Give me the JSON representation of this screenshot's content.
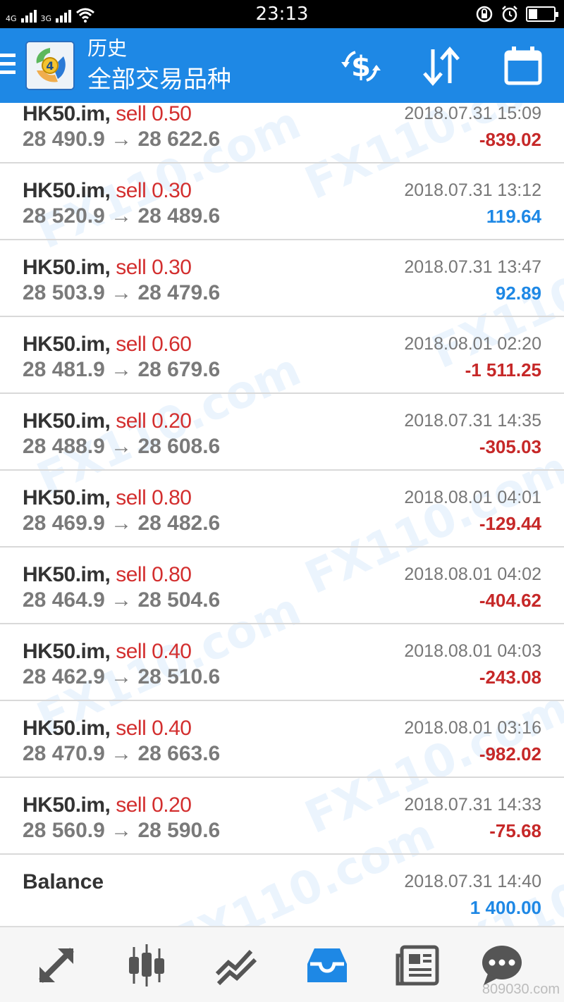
{
  "status_bar": {
    "network_1": "4G",
    "network_2": "3G",
    "time": "23:13"
  },
  "app_bar": {
    "title": "历史",
    "subtitle": "全部交易品种",
    "icons": [
      "menu-icon",
      "metatrader-logo",
      "currency-exchange-icon",
      "sort-icon",
      "calendar-icon"
    ]
  },
  "trades": [
    {
      "symbol": "HK50.im,",
      "side": "sell 0.50",
      "open": "28 490.9",
      "close": "28 622.6",
      "time": "2018.07.31 15:09",
      "profit": "-839.02",
      "sign": "neg"
    },
    {
      "symbol": "HK50.im,",
      "side": "sell 0.30",
      "open": "28 520.9",
      "close": "28 489.6",
      "time": "2018.07.31 13:12",
      "profit": "119.64",
      "sign": "pos"
    },
    {
      "symbol": "HK50.im,",
      "side": "sell 0.30",
      "open": "28 503.9",
      "close": "28 479.6",
      "time": "2018.07.31 13:47",
      "profit": "92.89",
      "sign": "pos"
    },
    {
      "symbol": "HK50.im,",
      "side": "sell 0.60",
      "open": "28 481.9",
      "close": "28 679.6",
      "time": "2018.08.01 02:20",
      "profit": "-1 511.25",
      "sign": "neg"
    },
    {
      "symbol": "HK50.im,",
      "side": "sell 0.20",
      "open": "28 488.9",
      "close": "28 608.6",
      "time": "2018.07.31 14:35",
      "profit": "-305.03",
      "sign": "neg"
    },
    {
      "symbol": "HK50.im,",
      "side": "sell 0.80",
      "open": "28 469.9",
      "close": "28 482.6",
      "time": "2018.08.01 04:01",
      "profit": "-129.44",
      "sign": "neg"
    },
    {
      "symbol": "HK50.im,",
      "side": "sell 0.80",
      "open": "28 464.9",
      "close": "28 504.6",
      "time": "2018.08.01 04:02",
      "profit": "-404.62",
      "sign": "neg"
    },
    {
      "symbol": "HK50.im,",
      "side": "sell 0.40",
      "open": "28 462.9",
      "close": "28 510.6",
      "time": "2018.08.01 04:03",
      "profit": "-243.08",
      "sign": "neg"
    },
    {
      "symbol": "HK50.im,",
      "side": "sell 0.40",
      "open": "28 470.9",
      "close": "28 663.6",
      "time": "2018.08.01 03:16",
      "profit": "-982.02",
      "sign": "neg"
    },
    {
      "symbol": "HK50.im,",
      "side": "sell 0.20",
      "open": "28 560.9",
      "close": "28 590.6",
      "time": "2018.07.31 14:33",
      "profit": "-75.68",
      "sign": "neg"
    }
  ],
  "arrow": "→",
  "balance": {
    "label": "Balance",
    "time": "2018.07.31 14:40",
    "amount": "1 400.00"
  },
  "watermark": "FX110.com",
  "corner_watermark": "809030.com",
  "bottom_nav": {
    "items": [
      "trade-icon",
      "quotes-chart-icon",
      "chart-icon",
      "history-icon",
      "news-icon",
      "chat-icon"
    ],
    "active": "history-icon"
  },
  "colors": {
    "accent": "#1e88e5",
    "negative": "#c62828",
    "side_sell": "#d32f2f"
  }
}
